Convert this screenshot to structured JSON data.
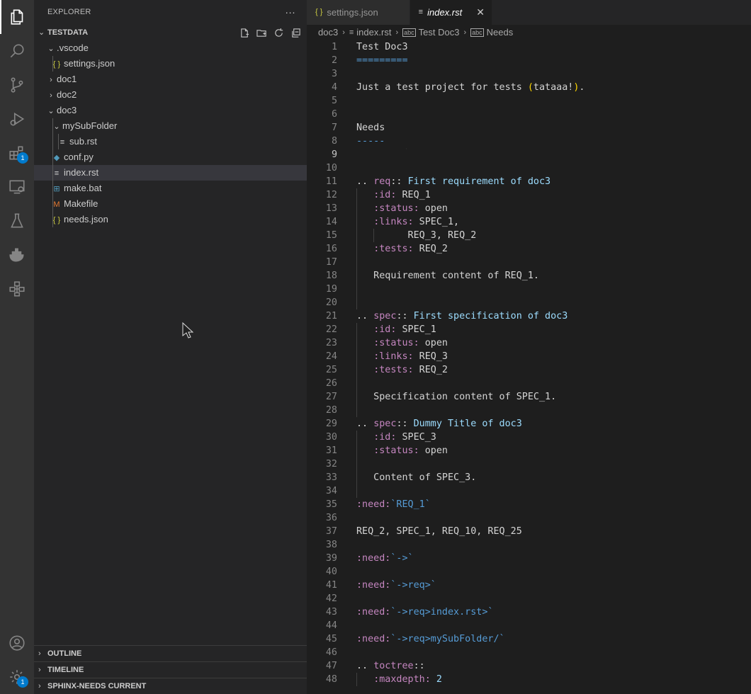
{
  "activity": {
    "items": [
      {
        "name": "explorer-icon"
      },
      {
        "name": "search-icon"
      },
      {
        "name": "source-control-icon"
      },
      {
        "name": "run-debug-icon"
      },
      {
        "name": "extensions-icon",
        "badge": "1"
      },
      {
        "name": "remote-explorer-icon"
      },
      {
        "name": "testing-icon"
      },
      {
        "name": "docker-icon"
      },
      {
        "name": "sphinx-needs-icon"
      }
    ],
    "accounts_icon": "account-icon",
    "settings_badge": "1"
  },
  "sidebar": {
    "title": "EXPLORER",
    "more": "···",
    "section": "TESTDATA",
    "tree": [
      {
        "label": ".vscode",
        "type": "folder-open",
        "depth": 1
      },
      {
        "label": "settings.json",
        "type": "json",
        "depth": 2
      },
      {
        "label": "doc1",
        "type": "folder-closed",
        "depth": 1
      },
      {
        "label": "doc2",
        "type": "folder-closed",
        "depth": 1
      },
      {
        "label": "doc3",
        "type": "folder-open",
        "depth": 1
      },
      {
        "label": "mySubFolder",
        "type": "folder-open",
        "depth": 2
      },
      {
        "label": "sub.rst",
        "type": "rst",
        "depth": 3
      },
      {
        "label": "conf.py",
        "type": "py",
        "depth": 2
      },
      {
        "label": "index.rst",
        "type": "rst",
        "depth": 2,
        "selected": true
      },
      {
        "label": "make.bat",
        "type": "bat",
        "depth": 2
      },
      {
        "label": "Makefile",
        "type": "makefile",
        "depth": 2
      },
      {
        "label": "needs.json",
        "type": "json",
        "depth": 2
      }
    ],
    "bottom_sections": [
      "OUTLINE",
      "TIMELINE",
      "SPHINX-NEEDS CURRENT"
    ]
  },
  "tabs": [
    {
      "label": "settings.json",
      "icon": "{ }",
      "active": false
    },
    {
      "label": "index.rst",
      "icon": "≡",
      "active": true
    }
  ],
  "breadcrumb": [
    "doc3",
    "index.rst",
    "Test Doc3",
    "Needs"
  ],
  "editor": {
    "current_line": 9,
    "lines": [
      [
        {
          "t": "Test Doc3"
        }
      ],
      [
        {
          "t": "=========",
          "c": "t-blue"
        }
      ],
      [],
      [
        {
          "t": "Just a test project for tests "
        },
        {
          "t": "(",
          "c": "t-paren"
        },
        {
          "t": "tataaa!"
        },
        {
          "t": ")",
          "c": "t-paren"
        },
        {
          "t": "."
        }
      ],
      [],
      [],
      [
        {
          "t": "Needs"
        }
      ],
      [
        {
          "t": "-----",
          "c": "t-blue"
        }
      ],
      [],
      [],
      [
        {
          "t": ".. "
        },
        {
          "t": "req",
          "c": "t-dir"
        },
        {
          "t": ":: "
        },
        {
          "t": "First requirement of doc3",
          "c": "t-val"
        }
      ],
      [
        {
          "t": "   "
        },
        {
          "t": ":id:",
          "c": "t-role"
        },
        {
          "t": " REQ_1"
        }
      ],
      [
        {
          "t": "   "
        },
        {
          "t": ":status:",
          "c": "t-role"
        },
        {
          "t": " open"
        }
      ],
      [
        {
          "t": "   "
        },
        {
          "t": ":links:",
          "c": "t-role"
        },
        {
          "t": " SPEC_1,"
        }
      ],
      [
        {
          "t": "         REQ_3, REQ_2"
        }
      ],
      [
        {
          "t": "   "
        },
        {
          "t": ":tests:",
          "c": "t-role"
        },
        {
          "t": " REQ_2"
        }
      ],
      [],
      [
        {
          "t": "   Requirement content of REQ_1."
        }
      ],
      [],
      [],
      [
        {
          "t": ".. "
        },
        {
          "t": "spec",
          "c": "t-dir"
        },
        {
          "t": ":: "
        },
        {
          "t": "First specification of doc3",
          "c": "t-val"
        }
      ],
      [
        {
          "t": "   "
        },
        {
          "t": ":id:",
          "c": "t-role"
        },
        {
          "t": " SPEC_1"
        }
      ],
      [
        {
          "t": "   "
        },
        {
          "t": ":status:",
          "c": "t-role"
        },
        {
          "t": " open"
        }
      ],
      [
        {
          "t": "   "
        },
        {
          "t": ":links:",
          "c": "t-role"
        },
        {
          "t": " REQ_3"
        }
      ],
      [
        {
          "t": "   "
        },
        {
          "t": ":tests:",
          "c": "t-role"
        },
        {
          "t": " REQ_2"
        }
      ],
      [],
      [
        {
          "t": "   Specification content of SPEC_1."
        }
      ],
      [],
      [
        {
          "t": ".. "
        },
        {
          "t": "spec",
          "c": "t-dir"
        },
        {
          "t": ":: "
        },
        {
          "t": "Dummy Title of doc3",
          "c": "t-val"
        }
      ],
      [
        {
          "t": "   "
        },
        {
          "t": ":id:",
          "c": "t-role"
        },
        {
          "t": " SPEC_3"
        }
      ],
      [
        {
          "t": "   "
        },
        {
          "t": ":status:",
          "c": "t-role"
        },
        {
          "t": " open"
        }
      ],
      [],
      [
        {
          "t": "   Content of SPEC_3."
        }
      ],
      [],
      [
        {
          "t": ":need:",
          "c": "t-role"
        },
        {
          "t": "`REQ_1`",
          "c": "t-blue"
        }
      ],
      [],
      [
        {
          "t": "REQ_2, SPEC_1, REQ_10, REQ_25"
        }
      ],
      [],
      [
        {
          "t": ":need:",
          "c": "t-role"
        },
        {
          "t": "`->`",
          "c": "t-blue"
        }
      ],
      [],
      [
        {
          "t": ":need:",
          "c": "t-role"
        },
        {
          "t": "`->req>`",
          "c": "t-blue"
        }
      ],
      [],
      [
        {
          "t": ":need:",
          "c": "t-role"
        },
        {
          "t": "`->req>index.rst>`",
          "c": "t-blue"
        }
      ],
      [],
      [
        {
          "t": ":need:",
          "c": "t-role"
        },
        {
          "t": "`->req>mySubFolder/`",
          "c": "t-blue"
        }
      ],
      [],
      [
        {
          "t": ".. "
        },
        {
          "t": "toctree",
          "c": "t-dir"
        },
        {
          "t": "::"
        }
      ],
      [
        {
          "t": "   "
        },
        {
          "t": ":maxdepth:",
          "c": "t-role"
        },
        {
          "t": " "
        },
        {
          "t": "2",
          "c": "t-val"
        }
      ]
    ]
  }
}
